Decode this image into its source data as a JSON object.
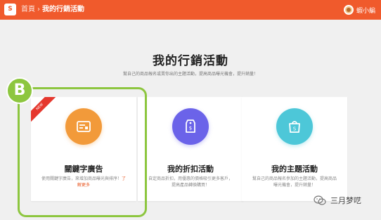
{
  "header": {
    "breadcrumb_home": "首頁",
    "breadcrumb_separator": "›",
    "breadcrumb_current": "我的行銷活動",
    "username": "蝦小編"
  },
  "main": {
    "title": "我的行銷活動",
    "subtitle": "幫自己的商品報名或賣你出的主題活動，提高商品曝光機會，提升銷量！"
  },
  "cards": [
    {
      "ribbon": "NEW",
      "title": "關鍵字廣告",
      "description": "使用關鍵字廣告，來增加商品曝光與排序！",
      "link": "了解更多",
      "icon": "keyword-ad-icon",
      "color": "#f29a3a"
    },
    {
      "title": "我的折扣活動",
      "description": "自定商品折扣，用優惠的價格吸引更多客戶，提高產品轉換購買！",
      "icon": "price-tag-icon",
      "color": "#6b63e9"
    },
    {
      "title": "我的主題活動",
      "description": "幫自己的商品報名參加的主題活動，提高商品曝光機會，提升銷量！",
      "icon": "shopping-bag-icon",
      "color": "#4dc7d8"
    }
  ],
  "annotation": {
    "badge_label": "B",
    "color": "#8dc63f"
  },
  "watermark": {
    "text": "三月梦呓"
  },
  "colors": {
    "brand": "#f05a2c",
    "link": "#e8541e"
  }
}
